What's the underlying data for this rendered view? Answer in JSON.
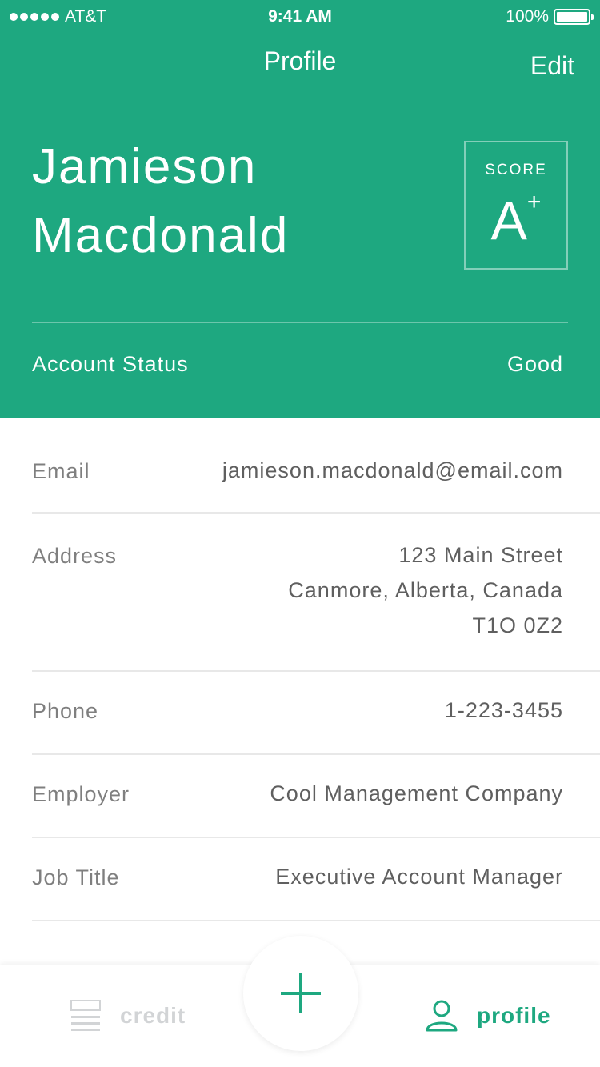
{
  "status_bar": {
    "carrier": "AT&T",
    "time": "9:41 AM",
    "battery": "100%"
  },
  "nav": {
    "title": "Profile",
    "edit_label": "Edit"
  },
  "profile": {
    "first_name": "Jamieson",
    "last_name": "Macdonald",
    "score_label": "SCORE",
    "score_grade": "A",
    "score_modifier": "+",
    "account_status_label": "Account Status",
    "account_status_value": "Good"
  },
  "details": {
    "email_label": "Email",
    "email_value": "jamieson.macdonald@email.com",
    "address_label": "Address",
    "address_line1": "123 Main Street",
    "address_line2": "Canmore, Alberta, Canada",
    "address_line3": "T1O 0Z2",
    "phone_label": "Phone",
    "phone_value": "1-223-3455",
    "employer_label": "Employer",
    "employer_value": "Cool Management Company",
    "job_title_label": "Job Title",
    "job_title_value": "Executive Account Manager"
  },
  "tab_bar": {
    "credit_label": "credit",
    "profile_label": "profile",
    "add_icon": "plus-icon",
    "credit_icon": "list-icon",
    "profile_icon": "person-icon"
  },
  "colors": {
    "accent": "#1ea880",
    "inactive_tab": "#d2d4d6"
  }
}
